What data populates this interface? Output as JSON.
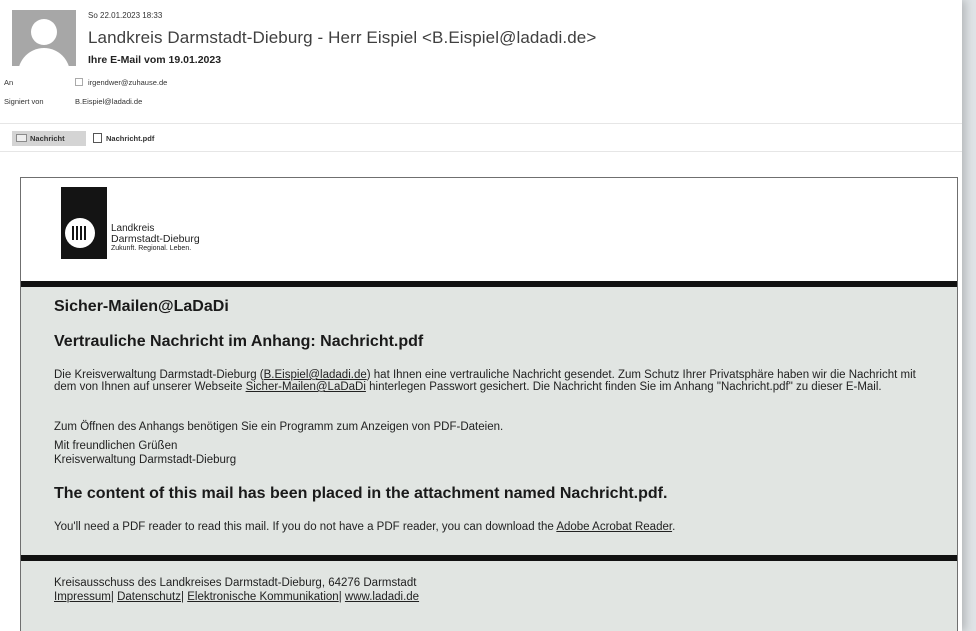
{
  "header": {
    "date": "So 22.01.2023 18:33",
    "sender": "Landkreis Darmstadt-Dieburg - Herr Eispiel <B.Eispiel@ladadi.de>",
    "subject": "Ihre E-Mail vom 19.01.2023",
    "to_label": "An",
    "to_value": "irgendwer@zuhause.de",
    "signed_label": "Signiert von",
    "signed_value": "B.Eispiel@ladadi.de"
  },
  "attachments": {
    "message_tab": "Nachricht",
    "pdf_file": "Nachricht.pdf"
  },
  "logo": {
    "line1": "Landkreis",
    "line2": "Darmstadt-Dieburg",
    "line3": "Zukunft. Regional. Leben."
  },
  "body": {
    "brand_heading": "Sicher-Mailen@LaDaDi",
    "title": "Vertrauliche Nachricht im Anhang: Nachricht.pdf",
    "para1_a": "Die Kreisverwaltung Darmstadt-Dieburg (",
    "para1_link1": "B.Eispiel@ladadi.de",
    "para1_b": ") hat Ihnen eine vertrauliche Nachricht gesendet. Zum Schutz Ihrer Privatsphäre haben wir die Nachricht mit dem von Ihnen auf unserer Webseite ",
    "para1_link2": "Sicher-Mailen@LaDaDi",
    "para1_c": " hinterlegen Passwort gesichert. Die Nachricht finden Sie im Anhang \"Nachricht.pdf\" zu dieser E-Mail.",
    "para2": "Zum Öffnen des Anhangs benötigen Sie ein Programm zum Anzeigen von PDF-Dateien.",
    "greeting1": "Mit freundlichen Grüßen",
    "greeting2": "Kreisverwaltung Darmstadt-Dieburg",
    "en_heading": "The content of this mail has been placed in the attachment named Nachricht.pdf.",
    "en_para_a": "You'll need a PDF reader to read this mail. If you do not have a PDF reader, you can download the ",
    "en_para_link": "Adobe Acrobat Reader",
    "en_para_b": "."
  },
  "footer": {
    "address": "Kreisausschuss des Landkreises Darmstadt-Dieburg, 64276 Darmstadt",
    "links": [
      "Impressum",
      "Datenschutz",
      "Elektronische Kommunikation",
      "www.ladadi.de"
    ],
    "separator": "|"
  }
}
